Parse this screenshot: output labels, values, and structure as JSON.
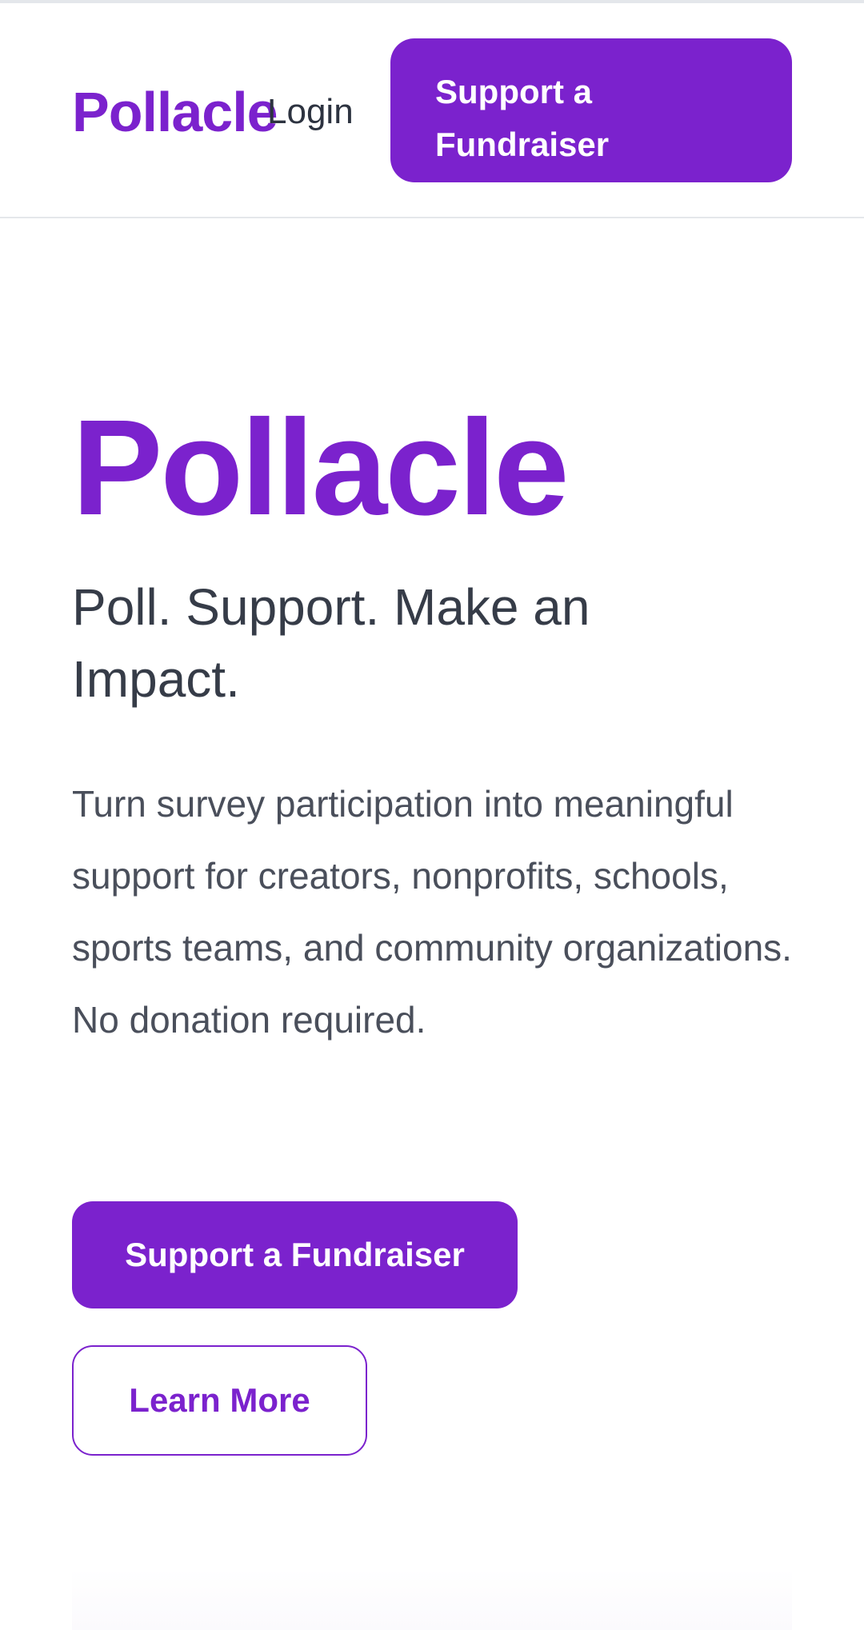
{
  "header": {
    "brand": "Pollacle",
    "login_label": "Login",
    "cta_label": "Support a Fundraiser"
  },
  "hero": {
    "title": "Pollacle",
    "tagline": "Poll. Support. Make an Impact.",
    "description": "Turn survey participation into meaningful support for creators, nonprofits, schools, sports teams, and community organizations. No donation required.",
    "primary_button": "Support a Fundraiser",
    "secondary_button": "Learn More"
  },
  "colors": {
    "brand": "#7b22cd",
    "heading_text": "#363c48",
    "body_text": "#4a4f5b"
  }
}
